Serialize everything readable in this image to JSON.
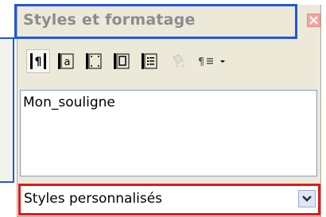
{
  "panel": {
    "title": "Styles et formatage",
    "close_icon": "close-icon",
    "toolbar": [
      {
        "name": "paragraph-styles-icon",
        "active": true
      },
      {
        "name": "character-styles-icon",
        "active": false
      },
      {
        "name": "frame-styles-icon",
        "active": false
      },
      {
        "name": "page-styles-icon",
        "active": false
      },
      {
        "name": "list-styles-icon",
        "active": false
      },
      {
        "name": "fill-format-mode-icon",
        "active": false
      },
      {
        "name": "new-style-from-selection-icon",
        "active": false
      }
    ],
    "styles": [
      "Mon_souligne"
    ],
    "filter": {
      "selected": "Styles personnalisés"
    }
  },
  "colors": {
    "highlight_blue": "#1f57e0",
    "highlight_red": "#e01a1a"
  }
}
